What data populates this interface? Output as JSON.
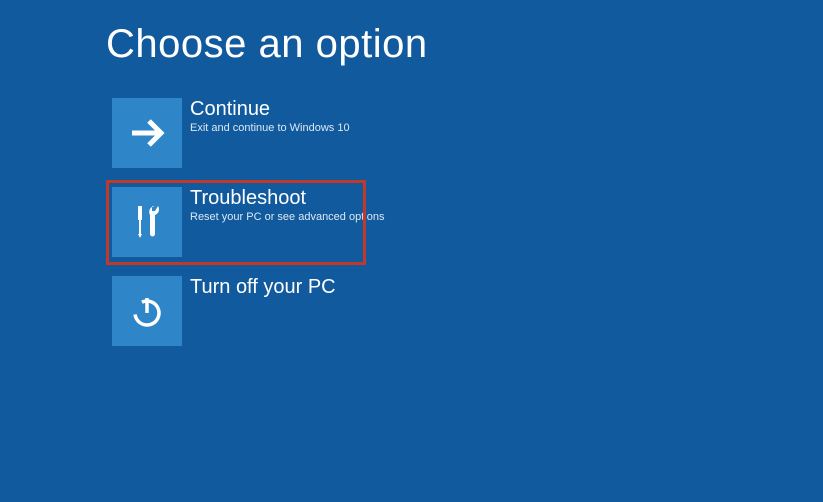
{
  "page": {
    "title": "Choose an option"
  },
  "options": {
    "continue": {
      "title": "Continue",
      "subtitle": "Exit and continue to Windows 10"
    },
    "troubleshoot": {
      "title": "Troubleshoot",
      "subtitle": "Reset your PC or see advanced options"
    },
    "turnoff": {
      "title": "Turn off your PC",
      "subtitle": ""
    }
  },
  "colors": {
    "background": "#115a9e",
    "tile": "#2e86c9",
    "highlight": "#c0392b"
  }
}
